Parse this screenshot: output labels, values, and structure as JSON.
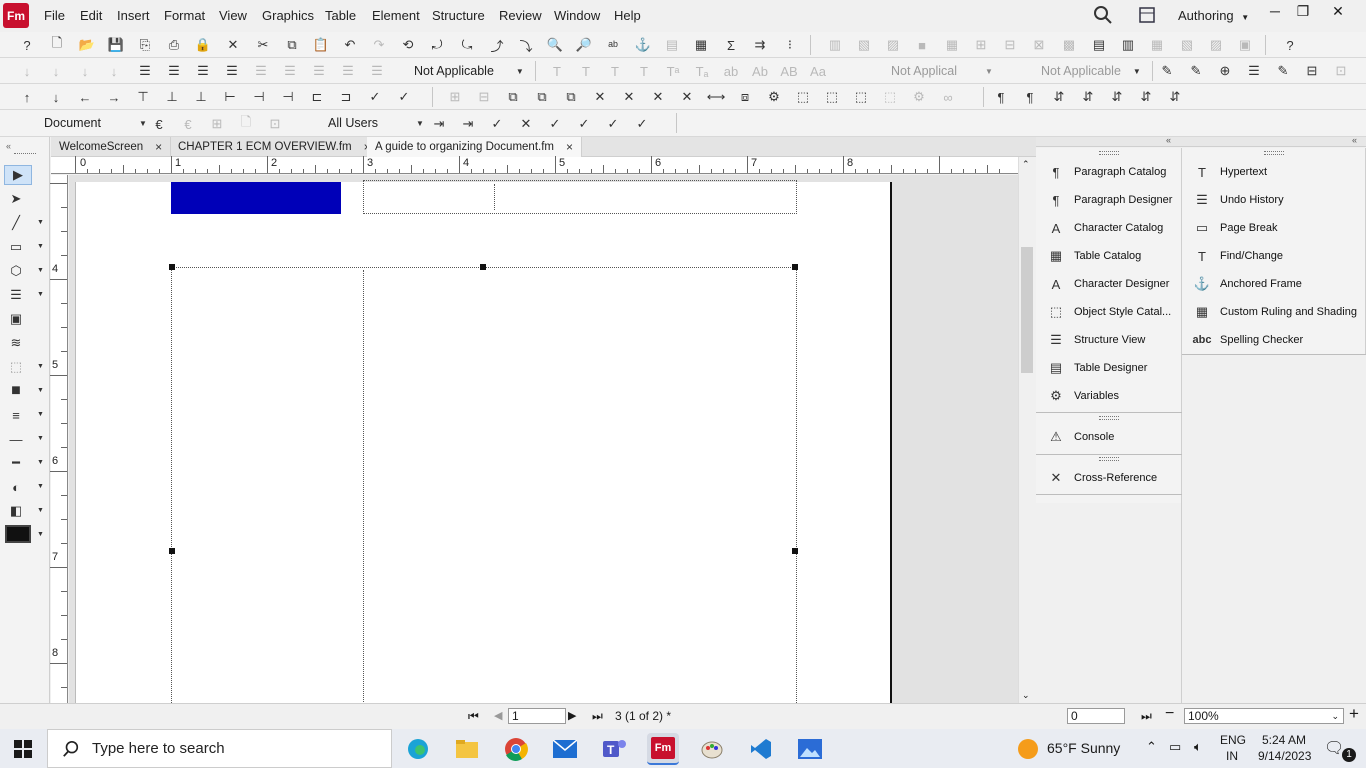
{
  "app": {
    "logo": "Fm",
    "workspace": "Authoring"
  },
  "menu": [
    "File",
    "Edit",
    "Insert",
    "Format",
    "View",
    "Graphics",
    "Table",
    "Element",
    "Structure",
    "Review",
    "Window",
    "Help"
  ],
  "toolbar2": {
    "dropdown1": "Not Applicable",
    "dropdown2": "Not Applical",
    "dropdown3": "Not Applicable"
  },
  "toolbar4": {
    "view_select": "Document",
    "users_select": "All Users"
  },
  "tabs": [
    {
      "label": "WelcomeScreen"
    },
    {
      "label": "CHAPTER 1 ECM OVERVIEW.fm"
    },
    {
      "label": "A guide to organizing Document.fm"
    }
  ],
  "ruler": {
    "h": [
      "0",
      "1",
      "2",
      "3",
      "4",
      "5",
      "6",
      "7",
      "8"
    ],
    "v": [
      "4",
      "5",
      "6",
      "7",
      "8"
    ]
  },
  "pods_left": [
    {
      "label": "Paragraph Catalog",
      "icon": "paragraph-catalog-icon"
    },
    {
      "label": "Paragraph Designer",
      "icon": "paragraph-designer-icon"
    },
    {
      "label": "Character Catalog",
      "icon": "character-catalog-icon"
    },
    {
      "label": "Table Catalog",
      "icon": "table-catalog-icon"
    },
    {
      "label": "Character Designer",
      "icon": "character-designer-icon"
    },
    {
      "label": "Object Style Catal...",
      "icon": "object-style-icon"
    },
    {
      "label": "Structure View",
      "icon": "structure-view-icon"
    },
    {
      "label": "Table Designer",
      "icon": "table-designer-icon"
    },
    {
      "label": "Variables",
      "icon": "variables-icon"
    },
    {
      "label": "Console",
      "icon": "warning-icon"
    },
    {
      "label": "Cross-Reference",
      "icon": "cross-reference-icon"
    }
  ],
  "pods_right": [
    {
      "label": "Hypertext",
      "icon": "hypertext-icon"
    },
    {
      "label": "Undo History",
      "icon": "undo-history-icon"
    },
    {
      "label": "Page Break",
      "icon": "page-break-icon"
    },
    {
      "label": "Find/Change",
      "icon": "find-change-icon"
    },
    {
      "label": "Anchored Frame",
      "icon": "anchored-frame-icon"
    },
    {
      "label": "Custom Ruling and Shading",
      "icon": "ruling-shading-icon"
    },
    {
      "label": "Spelling Checker",
      "icon": "spelling-checker-icon"
    }
  ],
  "status": {
    "page_input": "1",
    "page_info": "3 (1 of 2) *",
    "offset_input": "0",
    "zoom": "100%"
  },
  "taskbar": {
    "search_placeholder": "Type here to search",
    "weather": "65°F  Sunny",
    "lang1": "ENG",
    "lang2": "IN",
    "time": "5:24 AM",
    "date": "9/14/2023",
    "notif_count": "1"
  },
  "colors": {
    "accent_blue": "#0000b8",
    "app_red": "#c8102e"
  }
}
